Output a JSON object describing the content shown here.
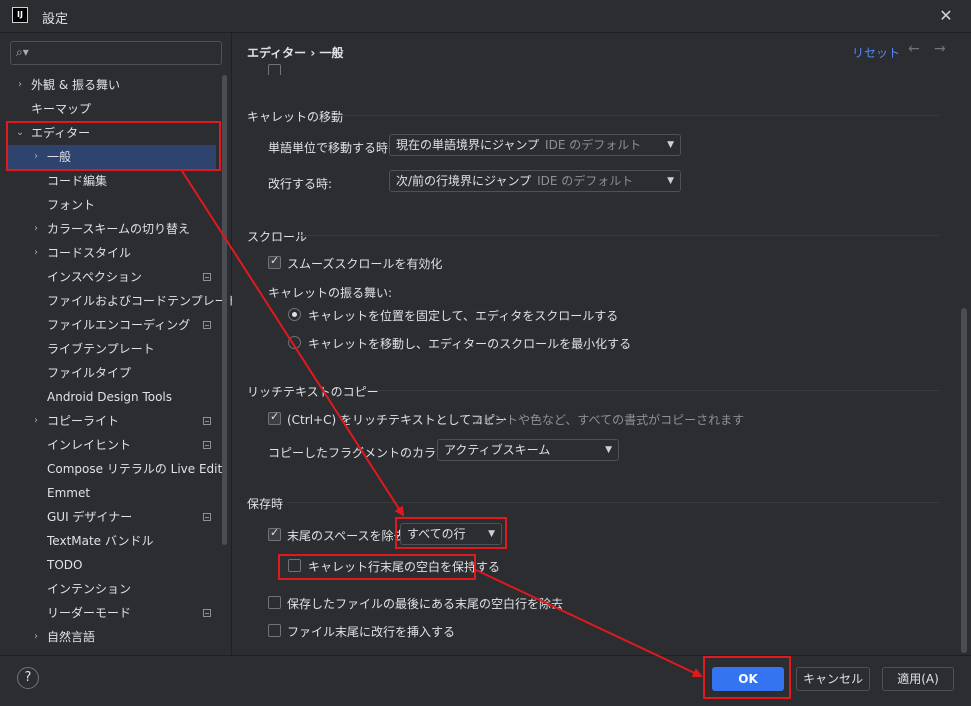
{
  "window": {
    "title": "設定",
    "app_icon_text": "IJ"
  },
  "sidebar": {
    "search": {
      "placeholder": ""
    },
    "items": [
      {
        "label": "外観 & 振る舞い"
      },
      {
        "label": "キーマップ"
      },
      {
        "label": "エディター"
      },
      {
        "label": "一般"
      },
      {
        "label": "コード編集"
      },
      {
        "label": "フォント"
      },
      {
        "label": "カラースキームの切り替え"
      },
      {
        "label": "コードスタイル"
      },
      {
        "label": "インスペクション"
      },
      {
        "label": "ファイルおよびコードテンプレート"
      },
      {
        "label": "ファイルエンコーディング"
      },
      {
        "label": "ライブテンプレート"
      },
      {
        "label": "ファイルタイプ"
      },
      {
        "label": "Android Design Tools"
      },
      {
        "label": "コピーライト"
      },
      {
        "label": "インレイヒント"
      },
      {
        "label": "Compose リテラルの Live Edit"
      },
      {
        "label": "Emmet"
      },
      {
        "label": "GUI デザイナー"
      },
      {
        "label": "TextMate バンドル"
      },
      {
        "label": "TODO"
      },
      {
        "label": "インテンション"
      },
      {
        "label": "リーダーモード"
      },
      {
        "label": "自然言語"
      }
    ]
  },
  "header": {
    "breadcrumb": "エディター  ›  一般",
    "reset": "リセット",
    "back": "←",
    "forward": "→"
  },
  "caret_move": {
    "title": "キャレットの移動",
    "word_label": "単語単位で移動する時:",
    "word_value": "現在の単語境界にジャンプ",
    "word_hint": "IDE のデフォルト",
    "line_label": "改行する時:",
    "line_value": "次/前の行境界にジャンプ",
    "line_hint": "IDE のデフォルト"
  },
  "scroll": {
    "title": "スクロール",
    "smooth": "スムーズスクロールを有効化",
    "caret_behavior": "キャレットの振る舞い:",
    "radio1": "キャレットを位置を固定して、エディタをスクロールする",
    "radio2": "キャレットを移動し、エディターのスクロールを最小化する"
  },
  "rich_copy": {
    "title": "リッチテキストのコピー",
    "copy": "(Ctrl+C) をリッチテキストとしてコピー",
    "copy_hint": "フォントや色など、すべての書式がコピーされます",
    "scheme_label": "コピーしたフラグメントのカラースキーム:",
    "scheme_value": "アクティブスキーム"
  },
  "on_save": {
    "title": "保存時",
    "strip_label": "末尾のスペースを除去:",
    "strip_value": "すべての行",
    "keep_caret": "キャレット行末尾の空白を保持する",
    "remove_blank": "保存したファイルの最後にある末尾の空白行を除去",
    "ensure_newline": "ファイル末尾に改行を挿入する"
  },
  "footer": {
    "help": "?",
    "ok": "OK",
    "cancel": "キャンセル",
    "apply": "適用(A)"
  },
  "colors": {
    "annotation": "#e0191e",
    "primary": "#3574f0",
    "selected": "#2e436e",
    "link": "#548af7"
  }
}
